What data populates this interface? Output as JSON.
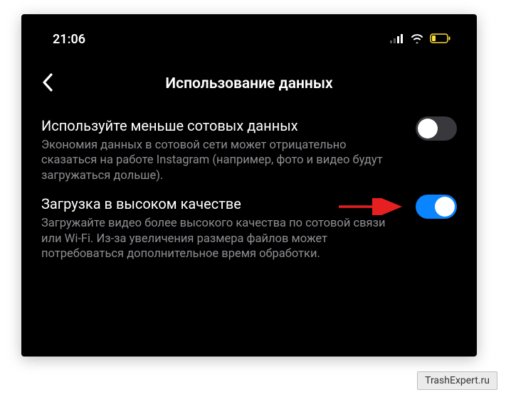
{
  "status": {
    "time": "21:06"
  },
  "header": {
    "title": "Использование данных"
  },
  "settings": [
    {
      "title": "Используйте меньше сотовых данных",
      "description": "Экономия данных в сотовой сети может отрицательно сказаться на работе Instagram (например, фото и видео будут загружаться дольше).",
      "enabled": false
    },
    {
      "title": "Загрузка в высоком качестве",
      "description": "Загружайте видео более высокого качества по сотовой связи или Wi-Fi. Из-за увеличения размера файлов может потребоваться дополнительное время обработки.",
      "enabled": true
    }
  ],
  "watermark": "TrashExpert.ru"
}
